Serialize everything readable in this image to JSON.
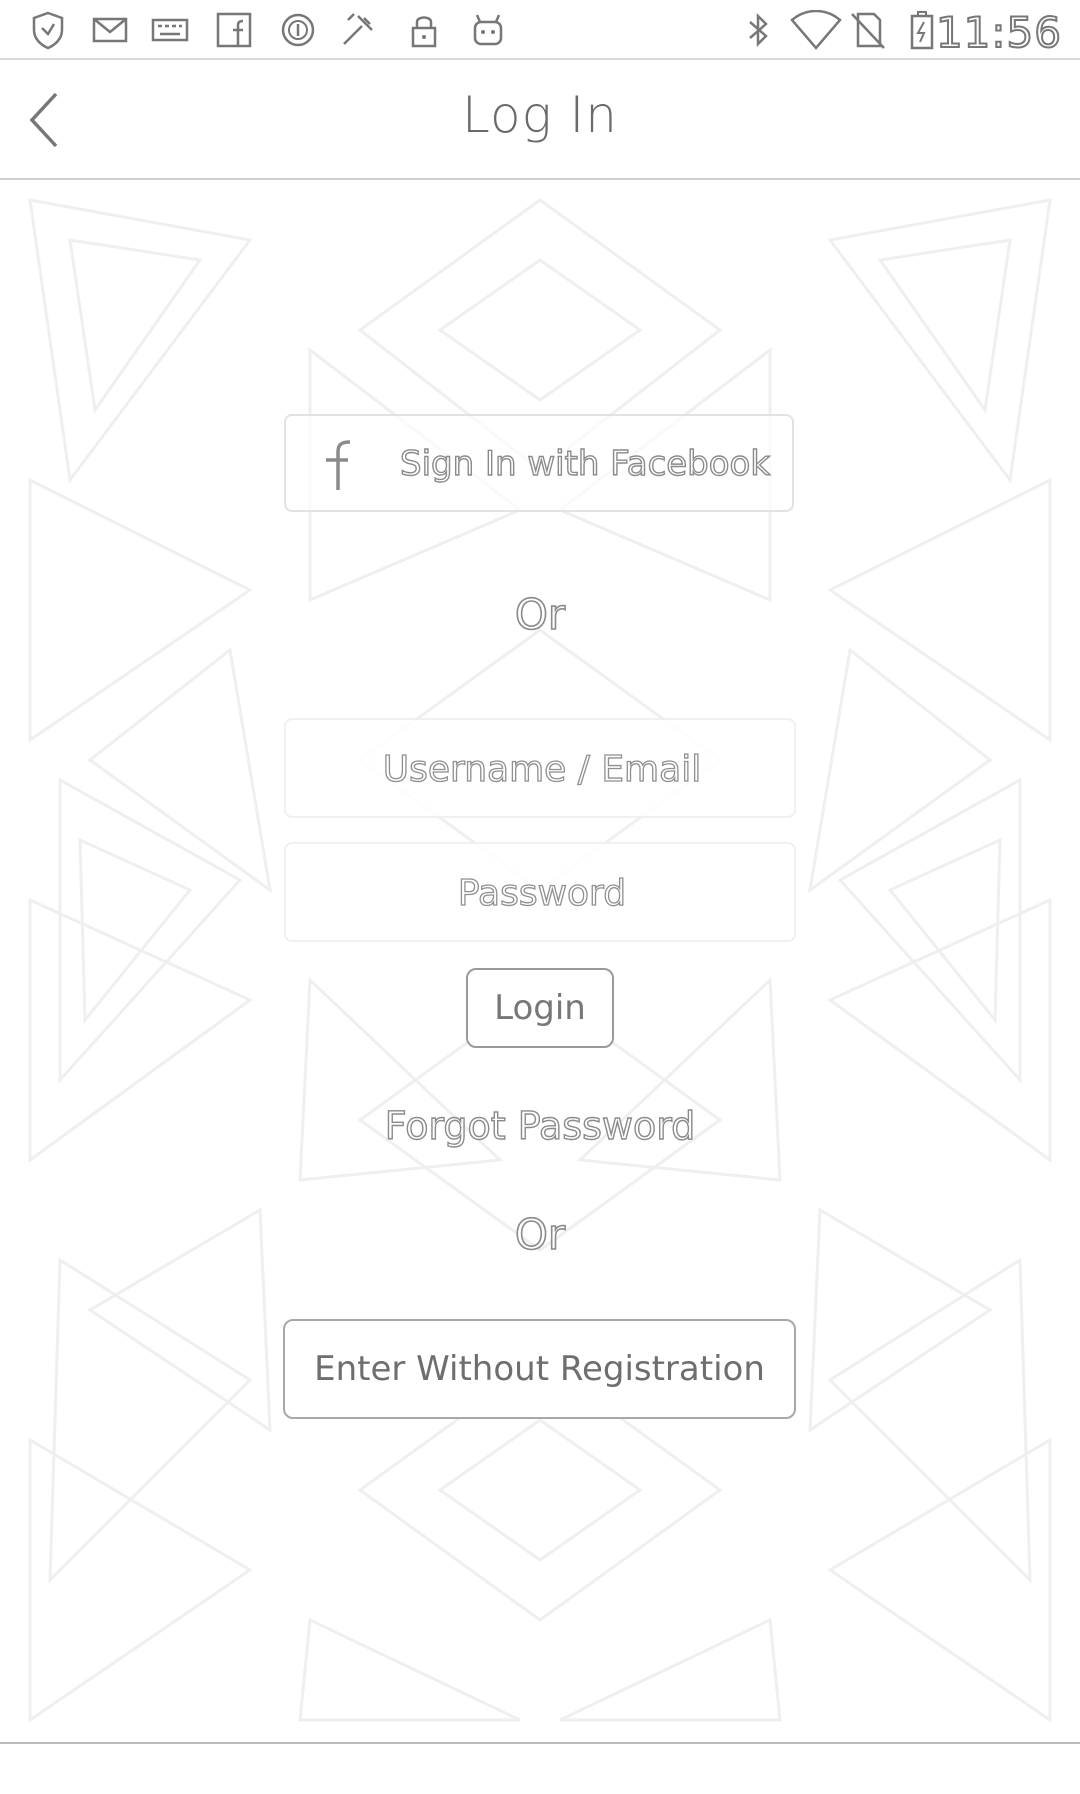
{
  "status_bar": {
    "time": "11:56",
    "icons": [
      "shield-icon",
      "mail-icon",
      "keyboard-icon",
      "facebook-icon",
      "circle-icon",
      "tool-icon",
      "lock-icon",
      "android-icon",
      "bluetooth-icon",
      "wifi-icon",
      "no-sim-icon",
      "battery-icon"
    ]
  },
  "header": {
    "title": "Log In",
    "back_icon": "chevron-left-icon"
  },
  "facebook_button": {
    "label": "Sign In with Facebook",
    "icon": "facebook-icon"
  },
  "divider_1": {
    "label": "Or"
  },
  "username_field": {
    "placeholder": "Username / Email",
    "value": ""
  },
  "password_field": {
    "placeholder": "Password",
    "value": ""
  },
  "login_button": {
    "label": "Login"
  },
  "forgot_password": {
    "label": "Forgot Password"
  },
  "divider_2": {
    "label": "Or"
  },
  "guest_button": {
    "label": "Enter Without Registration"
  },
  "colors": {
    "background": "#ffffff",
    "outline": "#8a8a8a",
    "pattern": "#f2f2f2"
  }
}
